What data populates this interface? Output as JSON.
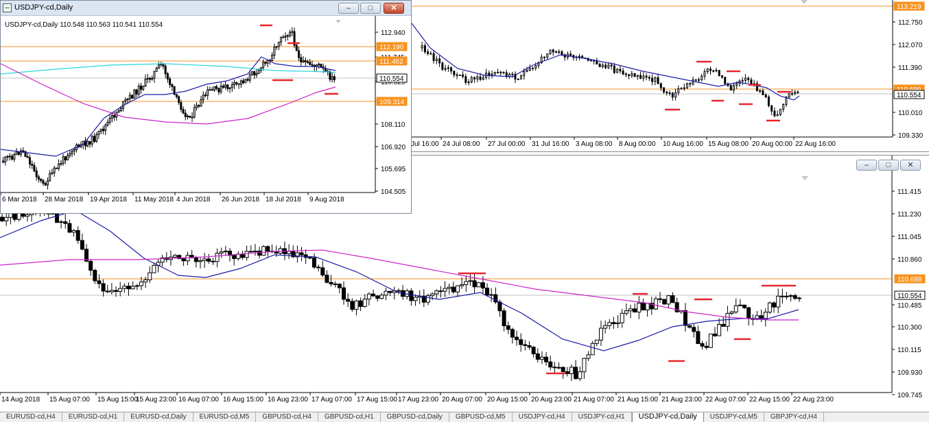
{
  "tl": {
    "title": "USDJPY-cd,Daily",
    "info": "USDJPY-cd,Daily  110.548 110.563 110.541 110.554",
    "price_ticks": [
      "112.940",
      "111.745",
      "110.525",
      "108.110",
      "106.920",
      "105.695",
      "104.505"
    ],
    "price_tags": [
      {
        "label": "112.190",
        "kind": "line",
        "color": "#f7921e"
      },
      {
        "label": "111.462",
        "kind": "line",
        "color": "#f7921e"
      },
      {
        "label": "110.554",
        "kind": "bid",
        "color": "#ffffff"
      },
      {
        "label": "109.314",
        "kind": "line",
        "color": "#f7921e"
      }
    ],
    "time_ticks": [
      "6 Mar 2018",
      "28 Mar 2018",
      "19 Apr 2018",
      "11 May 2018",
      "4 Jun 2018",
      "26 Jun 2018",
      "18 Jul 2018",
      "9 Aug 2018"
    ]
  },
  "tr": {
    "price_ticks": [
      "112.750",
      "112.070",
      "111.390",
      "110.010",
      "109.330"
    ],
    "price_tags": [
      {
        "label": "113.219",
        "kind": "line",
        "color": "#f7921e"
      },
      {
        "label": "110.699",
        "kind": "line",
        "color": "#f7921e"
      },
      {
        "label": "110.554",
        "kind": "bid",
        "color": "#ffffff"
      }
    ],
    "time_ticks": [
      "Jul 16:00",
      "24 Jul 08:00",
      "27 Jul 00:00",
      "31 Jul 16:00",
      "3 Aug 08:00",
      "8 Aug 00:00",
      "10 Aug 16:00",
      "15 Aug 08:00",
      "20 Aug 00:00",
      "22 Aug 16:00"
    ]
  },
  "bt": {
    "price_ticks": [
      "111.415",
      "111.230",
      "111.045",
      "110.860",
      "110.485",
      "110.300",
      "110.115",
      "109.930",
      "109.745"
    ],
    "price_tags": [
      {
        "label": "110.688",
        "kind": "line",
        "color": "#f7921e"
      },
      {
        "label": "110.554",
        "kind": "bid",
        "color": "#ffffff"
      }
    ],
    "time_ticks": [
      "14 Aug 2018",
      "15 Aug 07:00",
      "15 Aug 15:00",
      "15 Aug 23:00",
      "16 Aug 07:00",
      "16 Aug 15:00",
      "16 Aug 23:00",
      "17 Aug 07:00",
      "17 Aug 15:00",
      "17 Aug 23:00",
      "20 Aug 07:00",
      "20 Aug 15:00",
      "20 Aug 23:00",
      "21 Aug 07:00",
      "21 Aug 15:00",
      "21 Aug 23:00",
      "22 Aug 07:00",
      "22 Aug 15:00",
      "22 Aug 23:00"
    ]
  },
  "window_buttons": {
    "minimize": "–",
    "maximize": "□",
    "close": "✕"
  },
  "tabs": [
    "EURUSD-cd,H4",
    "EURUSD-cd,H1",
    "EURUSD-cd,Daily",
    "EURUSD-cd,M5",
    "GBPUSD-cd,H4",
    "GBPUSD-cd,H1",
    "GBPUSD-cd,Daily",
    "GBPUSD-cd,M5",
    "USDJPY-cd,H4",
    "USDJPY-cd,H1",
    "USDJPY-cd,Daily",
    "USDJPY-cd,M5",
    "GBPJPY-cd,H4"
  ],
  "active_tab": "USDJPY-cd,Daily",
  "colors": {
    "bull": "#ffffff",
    "bear": "#000000",
    "ma_fast": "#1a1aa6",
    "ma_slow": "#cc22cc",
    "ma_cyan": "#2ad6d6",
    "level": "#f7921e",
    "mark": "#e8242b",
    "bidline": "#c0c0c0"
  }
}
